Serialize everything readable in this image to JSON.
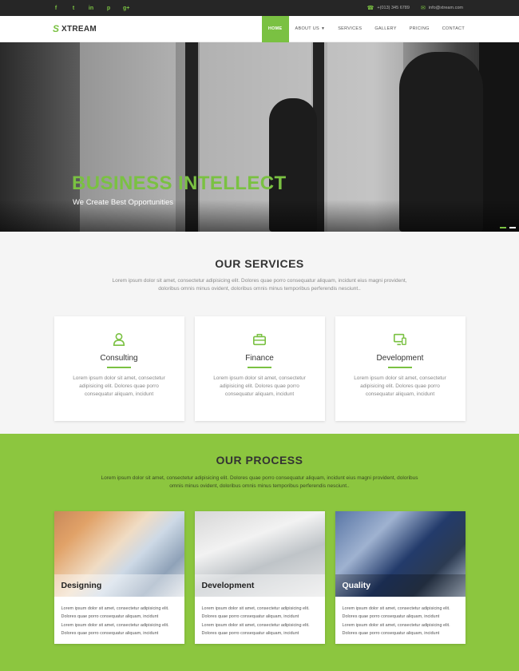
{
  "topbar": {
    "socials": [
      "f",
      "t",
      "in",
      "p",
      "g+"
    ],
    "phone": "+(013) 345 6789",
    "email": "info@xtream.com"
  },
  "nav": {
    "logo_mark": "⟆",
    "logo_text": "XTREAM",
    "items": [
      {
        "label": "HOME",
        "active": true
      },
      {
        "label": "ABOUT US",
        "dropdown": true
      },
      {
        "label": "SERVICES"
      },
      {
        "label": "GALLERY"
      },
      {
        "label": "PRICING"
      },
      {
        "label": "CONTACT"
      }
    ]
  },
  "hero": {
    "title": "BUSINESS INTELLECT",
    "subtitle": "We Create Best Opportunities"
  },
  "services": {
    "title": "OUR SERVICES",
    "description": "Lorem ipsum dolor sit amet, consectetur adipisicing elit. Dolores quae porro consequatur aliquam, incidunt eius magni provident, doloribus omnis minus ovident, doloribus omnis minus temporibus perferendis nesciunt..",
    "cards": [
      {
        "title": "Consulting",
        "icon": "user-icon",
        "text": "Lorem ipsum dolor sit amet, consectetur adipisicing elit. Dolores quae porro consequatur aliquam, incidunt"
      },
      {
        "title": "Finance",
        "icon": "briefcase-icon",
        "text": "Lorem ipsum dolor sit amet, consectetur adipisicing elit. Dolores quae porro consequatur aliquam, incidunt"
      },
      {
        "title": "Development",
        "icon": "devices-icon",
        "text": "Lorem ipsum dolor sit amet, consectetur adipisicing elit. Dolores quae porro consequatur aliquam, incidunt"
      }
    ]
  },
  "process": {
    "title": "OUR PROCESS",
    "description": "Lorem ipsum dolor sit amet, consectetur adipisicing elit. Dolores quae porro consequatur aliquam, incidunt eius magni provident, doloribus omnis minus ovident, doloribus omnis minus temporibus perferendis nesciunt..",
    "cards": [
      {
        "title": "Designing",
        "lines": [
          "Lorem ipsum dolor sit amet, consectetur adipisicing elit.",
          "Dolores quae porro consequatur aliquam, incidunt",
          "Lorem ipsum dolor sit amet, consectetur adipisicing elit.",
          "Dolores quae porro consequatur aliquam, incidunt"
        ]
      },
      {
        "title": "Development",
        "lines": [
          "Lorem ipsum dolor sit amet, consectetur adipisicing elit.",
          "Dolores quae porro consequatur aliquam, incidunt",
          "Lorem ipsum dolor sit amet, consectetur adipisicing elit.",
          "Dolores quae porro consequatur aliquam, incidunt"
        ]
      },
      {
        "title": "Quality",
        "lines": [
          "Lorem ipsum dolor sit amet, consectetur adipisicing elit.",
          "Dolores quae porro consequatur aliquam, incidunt",
          "Lorem ipsum dolor sit amet, consectetur adipisicing elit.",
          "Dolores quae porro consequatur aliquam, incidunt"
        ]
      }
    ]
  },
  "colors": {
    "accent": "#7ac142",
    "process_bg": "#8cc63f",
    "topbar": "#262626"
  }
}
